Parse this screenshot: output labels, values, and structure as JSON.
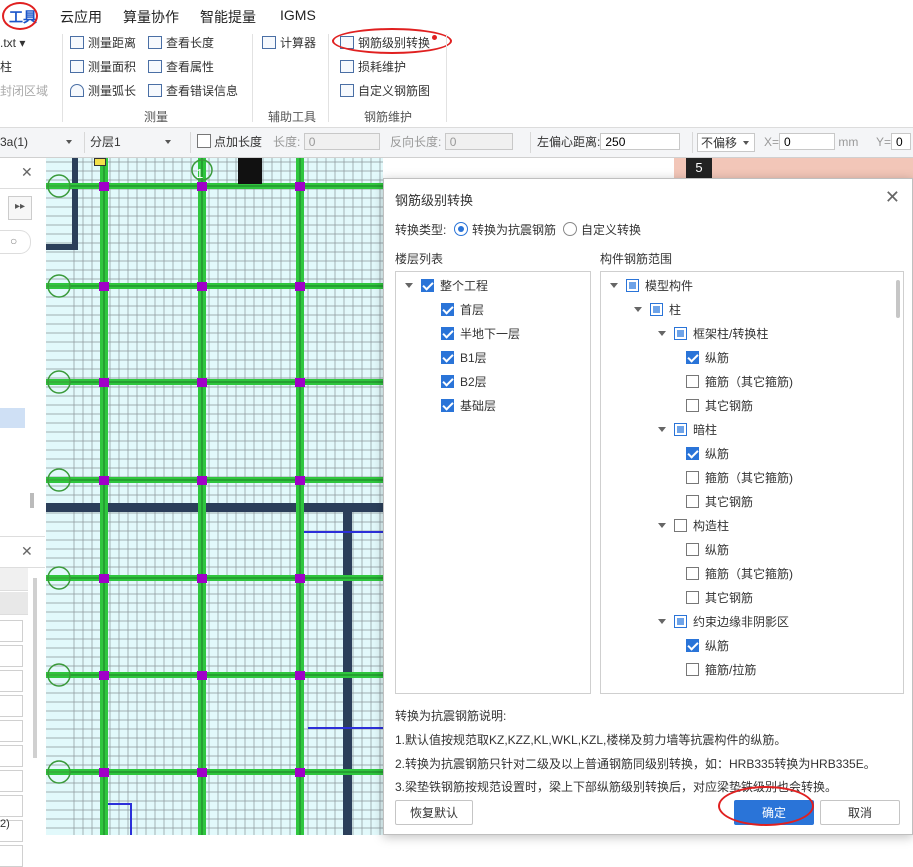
{
  "menu": {
    "items": [
      "工具",
      "云应用",
      "算量协作",
      "智能提量",
      "IGMS"
    ]
  },
  "ribbon": {
    "left_partial": [
      ".txt",
      "柱",
      "封闭区域"
    ],
    "measure_col1": [
      "测量距离",
      "测量面积",
      "测量弧长"
    ],
    "measure_col2": [
      "查看长度",
      "查看属性",
      "查看错误信息"
    ],
    "measure_group": "测量",
    "aux_items": [
      "计算器"
    ],
    "aux_group": "辅助工具",
    "rebar_items": [
      "钢筋级别转换",
      "损耗维护",
      "自定义钢筋图"
    ],
    "rebar_group": "钢筋维护"
  },
  "toolbar": {
    "layer_select": "3a(1)",
    "sublayer_select": "分层1",
    "point_length_label": "点加长度",
    "length_label": "长度:",
    "length_value": "0",
    "reverse_length_label": "反向长度:",
    "reverse_length_value": "0",
    "left_offset_label": "左偏心距离:",
    "left_offset_value": "250",
    "offset_select": "不偏移",
    "x_label": "X=",
    "x_value": "0",
    "x_unit": "mm",
    "y_label": "Y=",
    "y_value": "0"
  },
  "left_panel": {
    "bottom_fragment": "2)"
  },
  "canvas": {
    "axis_labels": [
      "1",
      "5"
    ],
    "colors": {
      "background": "#e2f9fb",
      "grid": "#6e7479",
      "rebar": "#2fc63e",
      "joint": "#a000c8",
      "beam": "#2b3f5a",
      "blue_line": "#2b2fd9"
    }
  },
  "dialog": {
    "title": "钢筋级别转换",
    "conversion_type_label": "转换类型:",
    "option_seismic": "转换为抗震钢筋",
    "option_custom": "自定义转换",
    "selected_option": "option_seismic",
    "floor_list_label": "楼层列表",
    "floors": [
      {
        "label": "整个工程",
        "checked": true
      },
      {
        "label": "首层",
        "checked": true
      },
      {
        "label": "半地下一层",
        "checked": true
      },
      {
        "label": "B1层",
        "checked": true
      },
      {
        "label": "B2层",
        "checked": true
      },
      {
        "label": "基础层",
        "checked": true
      }
    ],
    "component_range_label": "构件钢筋范围",
    "components": [
      {
        "label": "模型构件",
        "state": "partial"
      },
      {
        "label": "柱",
        "state": "partial"
      },
      {
        "label": "框架柱/转换柱",
        "state": "partial"
      },
      {
        "label": "纵筋",
        "state": "checked"
      },
      {
        "label": "箍筋（其它箍筋)",
        "state": "unchecked"
      },
      {
        "label": "其它钢筋",
        "state": "unchecked"
      },
      {
        "label": "暗柱",
        "state": "partial"
      },
      {
        "label": "纵筋",
        "state": "checked"
      },
      {
        "label": "箍筋（其它箍筋)",
        "state": "unchecked"
      },
      {
        "label": "其它钢筋",
        "state": "unchecked"
      },
      {
        "label": "构造柱",
        "state": "unchecked"
      },
      {
        "label": "纵筋",
        "state": "unchecked"
      },
      {
        "label": "箍筋（其它箍筋)",
        "state": "unchecked"
      },
      {
        "label": "其它钢筋",
        "state": "unchecked"
      },
      {
        "label": "约束边缘非阴影区",
        "state": "partial"
      },
      {
        "label": "纵筋",
        "state": "checked"
      },
      {
        "label": "箍筋/拉筋",
        "state": "unchecked"
      }
    ],
    "notes_title": "转换为抗震钢筋说明:",
    "notes": [
      "1.默认值按规范取KZ,KZZ,KL,WKL,KZL,楼梯及剪力墙等抗震构件的纵筋。",
      "2.转换为抗震钢筋只针对二级及以上普通钢筋同级别转换，如：HRB335转换为HRB335E。",
      "3.梁垫铁钢筋按规范设置时，梁上下部纵筋级别转换后，对应梁垫铁级别也会转换。"
    ],
    "restore_button": "恢复默认",
    "ok_button": "确定",
    "cancel_button": "取消"
  }
}
